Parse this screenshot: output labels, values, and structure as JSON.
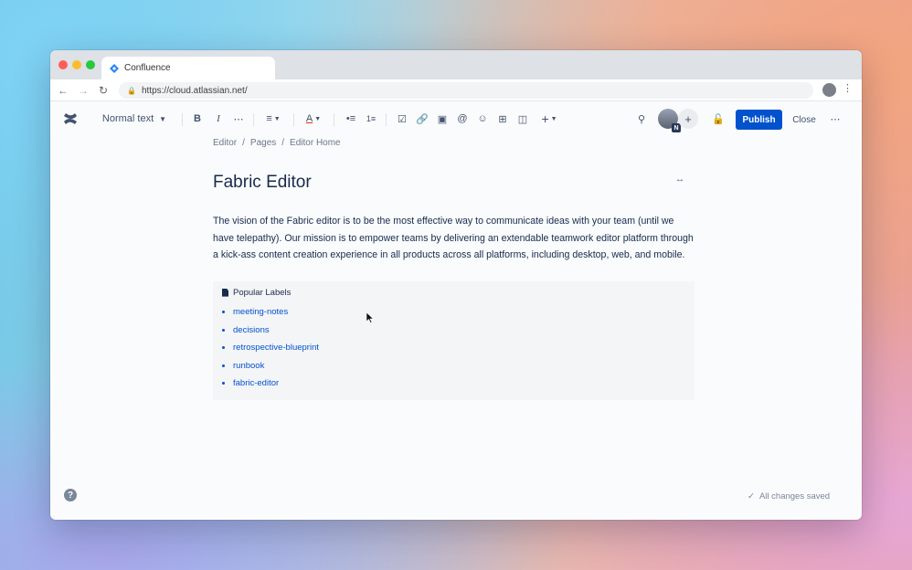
{
  "browser": {
    "tab_title": "Confluence",
    "url": "https://cloud.atlassian.net/"
  },
  "toolbar": {
    "text_style": "Normal text",
    "publish_label": "Publish",
    "close_label": "Close",
    "avatar_badge": "N"
  },
  "breadcrumb": [
    "Editor",
    "/",
    "Pages",
    "/",
    "Editor Home"
  ],
  "page": {
    "title": "Fabric Editor",
    "body": "The vision of the Fabric editor is to be the most effective way to communicate ideas with your team (until we have telepathy). Our mission is to empower teams by delivering an extendable teamwork editor platform through a kick-ass content creation experience in all products across all platforms, including desktop, web, and mobile."
  },
  "labels_panel": {
    "title": "Popular Labels",
    "items": [
      "meeting-notes",
      "decisions",
      "retrospective-blueprint",
      "runbook",
      "fabric-editor"
    ]
  },
  "footer": {
    "help": "?",
    "status": "All changes saved"
  },
  "colors": {
    "primary": "#0052cc",
    "text": "#172b4d",
    "subtle": "#6b778c"
  }
}
